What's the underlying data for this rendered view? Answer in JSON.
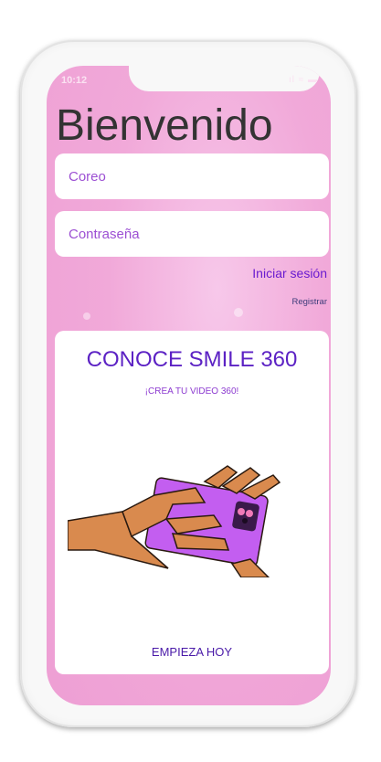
{
  "status_bar": {
    "time": "10:12",
    "icons": "ıl ≈ ▬"
  },
  "header": {
    "title": "Bienvenido"
  },
  "form": {
    "email_placeholder": "Coreo",
    "password_placeholder": "Contraseña",
    "login_label": "Iniciar sesión",
    "register_label": "Registrar"
  },
  "promo_card": {
    "title": "CONOCE SMILE 360",
    "subtitle": "¡CREA TU VIDEO 360!",
    "cta": "EMPIEZA HOY",
    "illustration_icon": "hands-holding-phone-icon"
  },
  "colors": {
    "background_pink": "#f1a9d9",
    "accent_purple": "#5c22c4",
    "phone_purple": "#c35ef0",
    "skin": "#d98a4e"
  }
}
